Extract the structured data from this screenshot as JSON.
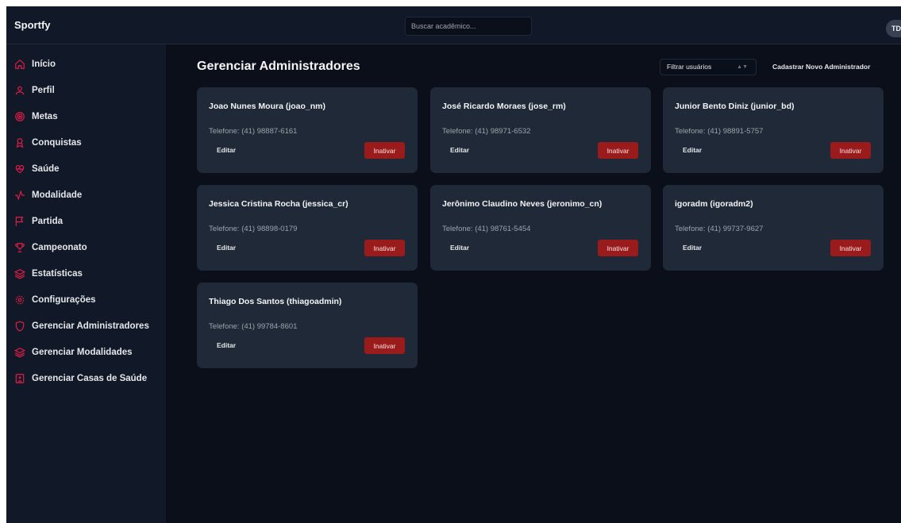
{
  "app": {
    "brand": "Sportfy",
    "avatar_initials": "TDS"
  },
  "search": {
    "placeholder": "Buscar acadêmico..."
  },
  "sidebar": {
    "items": [
      {
        "label": "Início",
        "icon": "home-icon"
      },
      {
        "label": "Perfil",
        "icon": "user-icon"
      },
      {
        "label": "Metas",
        "icon": "target-icon"
      },
      {
        "label": "Conquistas",
        "icon": "award-icon"
      },
      {
        "label": "Saúde",
        "icon": "heart-pulse-icon"
      },
      {
        "label": "Modalidade",
        "icon": "activity-icon"
      },
      {
        "label": "Partida",
        "icon": "flag-icon"
      },
      {
        "label": "Campeonato",
        "icon": "trophy-icon"
      },
      {
        "label": "Estatísticas",
        "icon": "layers-icon"
      },
      {
        "label": "Configurações",
        "icon": "gear-icon"
      },
      {
        "label": "Gerenciar Administradores",
        "icon": "shield-icon"
      },
      {
        "label": "Gerenciar Modalidades",
        "icon": "layers-icon"
      },
      {
        "label": "Gerenciar Casas de Saúde",
        "icon": "hospital-icon"
      }
    ]
  },
  "header": {
    "title": "Gerenciar Administradores",
    "filter_label": "Filtrar usuários",
    "new_admin_label": "Cadastrar Novo Administrador"
  },
  "card_labels": {
    "edit": "Editar",
    "deactivate": "Inativar"
  },
  "admins": [
    {
      "name": "Joao Nunes Moura (joao_nm)",
      "phone": "Telefone: (41) 98887-6161"
    },
    {
      "name": "José Ricardo Moraes (jose_rm)",
      "phone": "Telefone: (41) 98971-6532"
    },
    {
      "name": "Junior Bento Diniz (junior_bd)",
      "phone": "Telefone: (41) 98891-5757"
    },
    {
      "name": "Jessica Cristina Rocha (jessica_cr)",
      "phone": "Telefone: (41) 98898-0179"
    },
    {
      "name": "Jerônimo Claudino Neves (jeronimo_cn)",
      "phone": "Telefone: (41) 98761-5454"
    },
    {
      "name": "igoradm (igoradm2)",
      "phone": "Telefone: (41) 99737-9627"
    },
    {
      "name": "Thiago Dos Santos (thiagoadmin)",
      "phone": "Telefone: (41) 99784-8601"
    }
  ],
  "colors": {
    "accent": "#e11d48",
    "deactivate": "#991b1b",
    "card": "#1f2937",
    "background": "#0b0f19"
  }
}
